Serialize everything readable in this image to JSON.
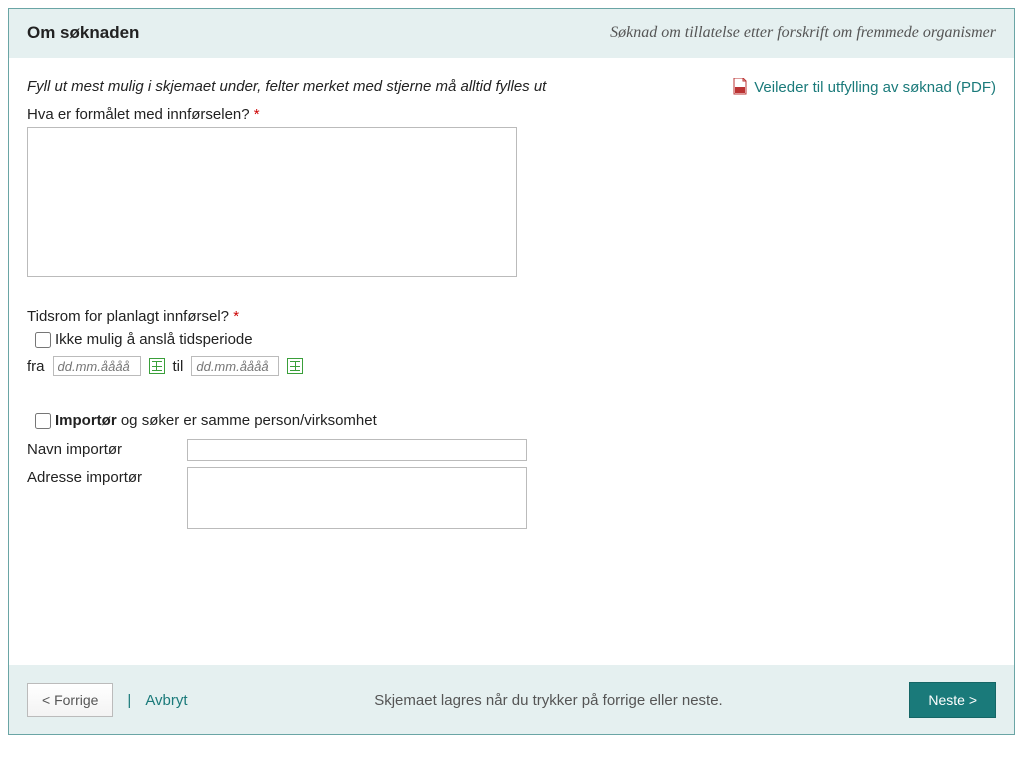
{
  "header": {
    "title": "Om søknaden",
    "subtitle": "Søknad om tillatelse etter forskrift om fremmede organismer"
  },
  "instructions": "Fyll ut mest mulig i skjemaet under, felter merket med stjerne må alltid fylles ut",
  "pdf_link": "Veileder til utfylling av søknad (PDF)",
  "purpose": {
    "label": "Hva er formålet med innførselen? ",
    "value": ""
  },
  "timeframe": {
    "label": "Tidsrom for planlagt innførsel? ",
    "checkbox_label": "Ikke mulig å anslå tidsperiode",
    "from_label": "fra",
    "to_label": "til",
    "date_placeholder": "dd.mm.åååå",
    "from_value": "",
    "to_value": ""
  },
  "importer": {
    "checkbox_bold": "Importør",
    "checkbox_rest": " og søker er samme person/virksomhet",
    "name_label": "Navn importør",
    "name_value": "",
    "address_label": "Adresse importør",
    "address_value": ""
  },
  "footer": {
    "prev": "< Forrige",
    "cancel": "Avbryt",
    "info": "Skjemaet lagres når du trykker på forrige eller neste.",
    "next": "Neste >"
  }
}
